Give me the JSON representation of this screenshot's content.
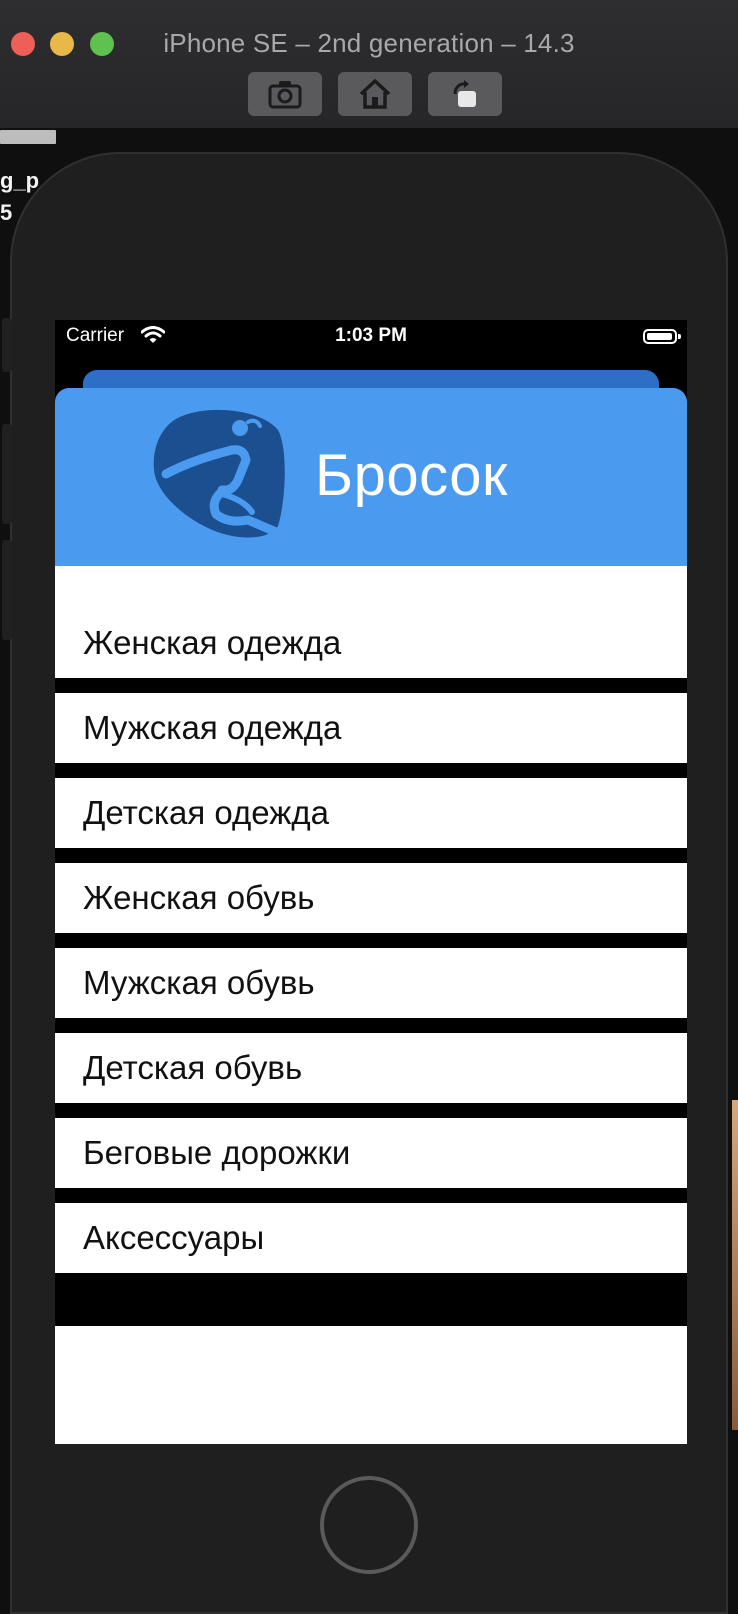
{
  "window": {
    "title": "iPhone SE – 2nd generation – 14.3",
    "toolbar": {
      "screenshot_icon": "camera-icon",
      "home_icon": "home-icon",
      "rotate_icon": "rotate-icon"
    }
  },
  "background": {
    "left_text_1": "g_p",
    "left_text_2": "5"
  },
  "status_bar": {
    "carrier": "Carrier",
    "time": "1:03 PM"
  },
  "header": {
    "brand": "Бросок",
    "background_color": "#4a9bf0",
    "logo_icon": "handball-player-icon"
  },
  "categories": [
    "Женская одежда",
    "Мужская одежда",
    "Детская одежда",
    "Женская обувь",
    "Мужская обувь",
    "Детская обувь",
    "Беговые дорожки",
    "Аксессуары"
  ]
}
